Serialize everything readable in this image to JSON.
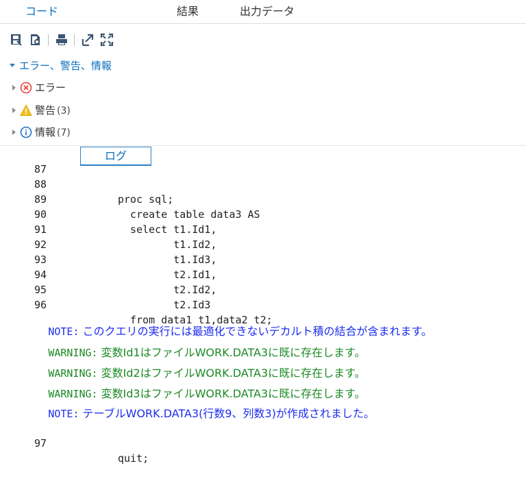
{
  "tabs": [
    {
      "label": "コード"
    },
    {
      "label": "ログ"
    },
    {
      "label": "結果"
    },
    {
      "label": "出力データ"
    }
  ],
  "toolbar": {
    "icons": [
      "save-log-icon",
      "export-document-icon",
      "print-icon",
      "expand-icon",
      "fullscreen-icon"
    ]
  },
  "tree": {
    "root_label": "エラー、警告、情報",
    "error": {
      "label": "エラー",
      "count": ""
    },
    "warning": {
      "label": "警告",
      "count": "(3)"
    },
    "info": {
      "label": "情報",
      "count": "(7)"
    }
  },
  "log": {
    "lines": [
      {
        "num": "87",
        "code": ""
      },
      {
        "num": "88",
        "code": "proc sql;"
      },
      {
        "num": "89",
        "code": "  create table data3 AS"
      },
      {
        "num": "90",
        "code": "  select t1.Id1,"
      },
      {
        "num": "91",
        "code": "         t1.Id2,"
      },
      {
        "num": "92",
        "code": "         t1.Id3,"
      },
      {
        "num": "93",
        "code": "         t2.Id1,"
      },
      {
        "num": "94",
        "code": "         t2.Id2,"
      },
      {
        "num": "95",
        "code": "         t2.Id3"
      },
      {
        "num": "96",
        "code": "  from data1 t1,data2 t2;"
      }
    ],
    "messages": [
      {
        "type": "note",
        "keyword": "NOTE:",
        "text": " このクエリの実行には最適化できないデカルト積の結合が含まれます。"
      },
      {
        "type": "warn",
        "keyword": "WARNING:",
        "text": " 変数Id1はファイルWORK.DATA3に既に存在します。"
      },
      {
        "type": "warn",
        "keyword": "WARNING:",
        "text": " 変数Id2はファイルWORK.DATA3に既に存在します。"
      },
      {
        "type": "warn",
        "keyword": "WARNING:",
        "text": " 変数Id3はファイルWORK.DATA3に既に存在します。"
      },
      {
        "type": "note",
        "keyword": "NOTE:",
        "text": " テーブルWORK.DATA3(行数9、列数3)が作成されました。"
      }
    ],
    "final_line": {
      "num": "97",
      "code": "quit;"
    }
  },
  "colors": {
    "accent": "#0a6ebd",
    "note": "#1c2ef0",
    "warning": "#1b8a24",
    "error_icon": "#e8433c",
    "warning_icon": "#f2c21b",
    "info_icon": "#1a73c8"
  }
}
